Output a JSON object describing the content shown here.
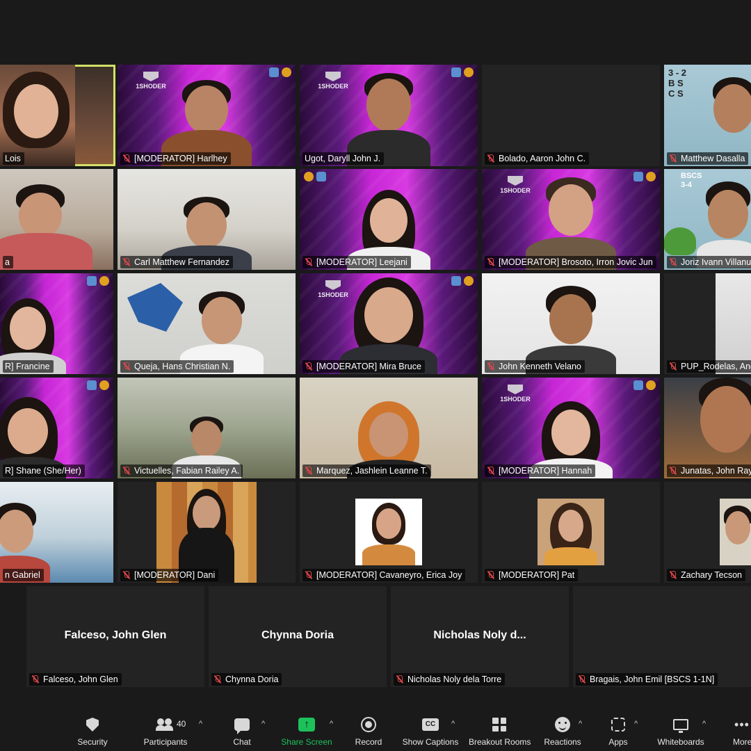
{
  "participants": {
    "row1": [
      {
        "name": "Lois",
        "muted": false
      },
      {
        "name": "[MODERATOR] Harlhey",
        "muted": true
      },
      {
        "name": "Ugot, Daryll John J.",
        "muted": false
      },
      {
        "name": "Bolado, Aaron John C.",
        "muted": true
      },
      {
        "name": "Matthew Dasalla",
        "muted": true
      }
    ],
    "row2": [
      {
        "name": "a",
        "muted": false
      },
      {
        "name": "Carl Matthew Fernandez",
        "muted": true
      },
      {
        "name": "[MODERATOR] Leejani",
        "muted": true
      },
      {
        "name": "[MODERATOR] Brosoto, Irron Jovic Jun",
        "muted": true
      },
      {
        "name": "Joriz Ivann Villanu",
        "muted": true
      }
    ],
    "row3": [
      {
        "name": "R] Francine",
        "muted": false
      },
      {
        "name": "Queja, Hans Christian N.",
        "muted": true
      },
      {
        "name": "[MODERATOR] Mira Bruce",
        "muted": true
      },
      {
        "name": "John Kenneth Velano",
        "muted": true
      },
      {
        "name": "PUP_Rodelas, Ang",
        "muted": true
      }
    ],
    "row4": [
      {
        "name": "R] Shane (She/Her)",
        "muted": false
      },
      {
        "name": "Victuelles, Fabian Railey A.",
        "muted": true
      },
      {
        "name": "Marquez, Jashlein Leanne T.",
        "muted": true
      },
      {
        "name": "[MODERATOR] Hannah",
        "muted": true
      },
      {
        "name": "Junatas, John Ray",
        "muted": true
      }
    ],
    "row5": [
      {
        "name": "n Gabriel",
        "muted": false
      },
      {
        "name": "[MODERATOR] Dani",
        "muted": true
      },
      {
        "name": "[MODERATOR] Cavaneyro, Erica Joy",
        "muted": true
      },
      {
        "name": "[MODERATOR] Pat",
        "muted": true
      },
      {
        "name": "Zachary Tecson",
        "muted": true
      }
    ],
    "row6": [
      {
        "display": "Falceso, John Glen",
        "name": "Falceso, John Glen",
        "muted": true
      },
      {
        "display": "Chynna Doria",
        "name": "Chynna Doria",
        "muted": true
      },
      {
        "display": "Nicholas Noly d...",
        "name": "Nicholas Noly dela Torre",
        "muted": true
      },
      {
        "display": "",
        "name": "Bragais, John Emil [BSCS 1-1N]",
        "muted": true
      }
    ]
  },
  "overlay_text": {
    "bscs_1": "3 - 2\nB S C S",
    "bscs_2": "BSCS\n3-4",
    "brand": "1SHODER"
  },
  "toolbar": {
    "security": "Security",
    "participants": "Participants",
    "participants_count": "40",
    "chat": "Chat",
    "share_screen": "Share Screen",
    "record": "Record",
    "show_captions": "Show Captions",
    "breakout_rooms": "Breakout Rooms",
    "reactions": "Reactions",
    "apps": "Apps",
    "whiteboards": "Whiteboards",
    "more": "More",
    "cc": "CC",
    "caret": "^"
  },
  "colors": {
    "background": "#1a1a1a",
    "active_speaker_border": "#d3e06a",
    "share_green": "#1dc15b",
    "muted_red": "#e0474c",
    "magenta_bg": "#c726d6"
  }
}
